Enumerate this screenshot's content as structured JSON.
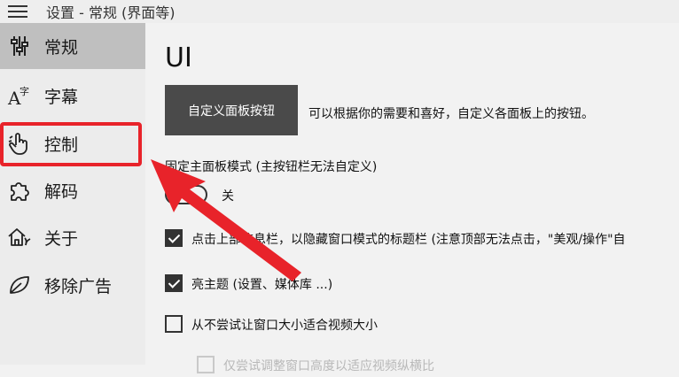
{
  "window": {
    "title": "设置 - 常规 (界面等)"
  },
  "sidebar": {
    "items": [
      {
        "label": "常规",
        "icon": "sliders-icon",
        "active": true
      },
      {
        "label": "字幕",
        "icon": "subtitle-icon",
        "active": false
      },
      {
        "label": "控制",
        "icon": "hand-pointer-icon",
        "active": false
      },
      {
        "label": "解码",
        "icon": "puzzle-icon",
        "active": false
      },
      {
        "label": "关于",
        "icon": "house-icon",
        "active": false
      },
      {
        "label": "移除广告",
        "icon": "leaf-icon",
        "active": false
      }
    ]
  },
  "main": {
    "section_title": "UI",
    "customize_button": "自定义面板按钮",
    "customize_desc": "可以根据你的需要和喜好，自定义各面板上的按钮。",
    "fixed_panel_label": "固定主面板模式 (主按钮栏无法自定义)",
    "toggle_state": "关",
    "checkboxes": [
      {
        "label": "点击上部信息栏，以隐藏窗口模式的标题栏 (注意顶部无法点击，\"美观/操作\"自",
        "checked": true,
        "disabled": false
      },
      {
        "label": "亮主题 (设置、媒体库 ...)",
        "checked": true,
        "disabled": false
      },
      {
        "label": "从不尝试让窗口大小适合视频大小",
        "checked": false,
        "disabled": false
      },
      {
        "label": "仅尝试调整窗口高度以适应视频纵横比",
        "checked": false,
        "disabled": true
      }
    ]
  },
  "colors": {
    "highlight": "#e8232a",
    "active_nav": "#bfbfbf",
    "button_bg": "#4a4a4a"
  }
}
